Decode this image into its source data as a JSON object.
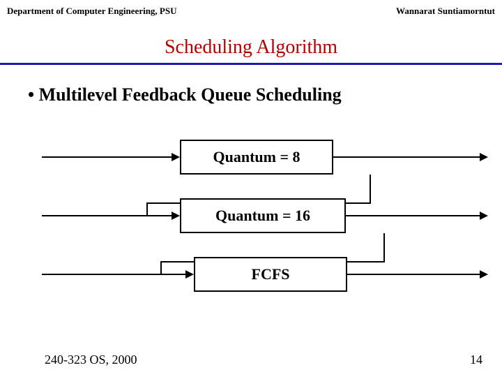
{
  "header": {
    "left": "Department of Computer Engineering, PSU",
    "right": "Wannarat  Suntiamorntut"
  },
  "title": "Scheduling  Algorithm",
  "bullet": "• Multilevel  Feedback Queue  Scheduling",
  "queues": {
    "q1": "Quantum = 8",
    "q2": "Quantum = 16",
    "q3": "FCFS"
  },
  "footer": {
    "course": "240-323  OS, 2000",
    "page": "14"
  }
}
